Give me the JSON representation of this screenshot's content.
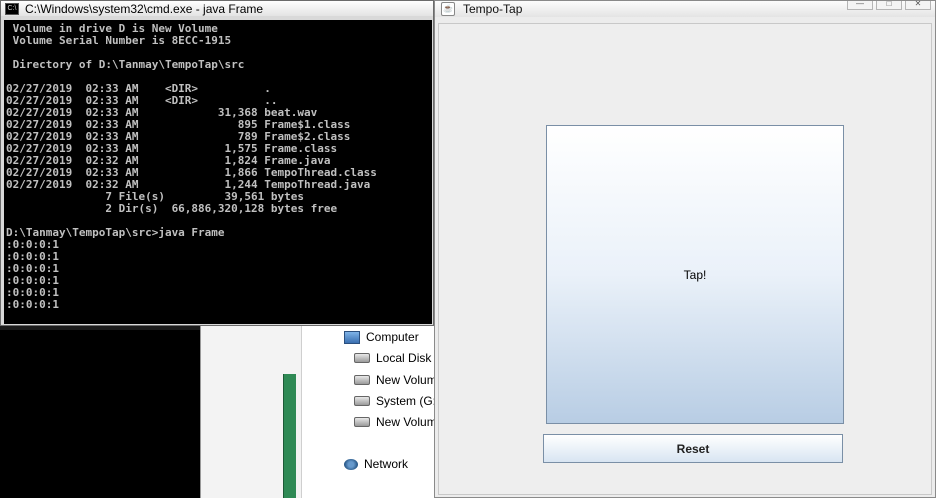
{
  "cmd": {
    "title": "C:\\Windows\\system32\\cmd.exe - java  Frame",
    "icon_text": "C:\\",
    "output": " Volume in drive D is New Volume\n Volume Serial Number is 8ECC-1915\n\n Directory of D:\\Tanmay\\TempoTap\\src\n\n02/27/2019  02:33 AM    <DIR>          .\n02/27/2019  02:33 AM    <DIR>          ..\n02/27/2019  02:33 AM            31,368 beat.wav\n02/27/2019  02:33 AM               895 Frame$1.class\n02/27/2019  02:33 AM               789 Frame$2.class\n02/27/2019  02:33 AM             1,575 Frame.class\n02/27/2019  02:32 AM             1,824 Frame.java\n02/27/2019  02:33 AM             1,866 TempoThread.class\n02/27/2019  02:32 AM             1,244 TempoThread.java\n               7 File(s)         39,561 bytes\n               2 Dir(s)  66,886,320,128 bytes free\n\nD:\\Tanmay\\TempoTap\\src>java Frame\n:0:0:0:1\n:0:0:0:1\n:0:0:0:1\n:0:0:0:1\n:0:0:0:1\n:0:0:0:1"
  },
  "frame": {
    "title": "Tempo-Tap",
    "tap_label": "Tap!",
    "reset_label": "Reset"
  },
  "explorer": {
    "items": [
      {
        "label": "Computer",
        "icon": "computer-icon"
      },
      {
        "label": "Local Disk (",
        "icon": "drive-icon"
      },
      {
        "label": "New Volum",
        "icon": "drive-icon"
      },
      {
        "label": "System (G:)",
        "icon": "drive-icon"
      },
      {
        "label": "New Volum",
        "icon": "drive-icon"
      },
      {
        "label": "Network",
        "icon": "network-icon"
      }
    ]
  }
}
